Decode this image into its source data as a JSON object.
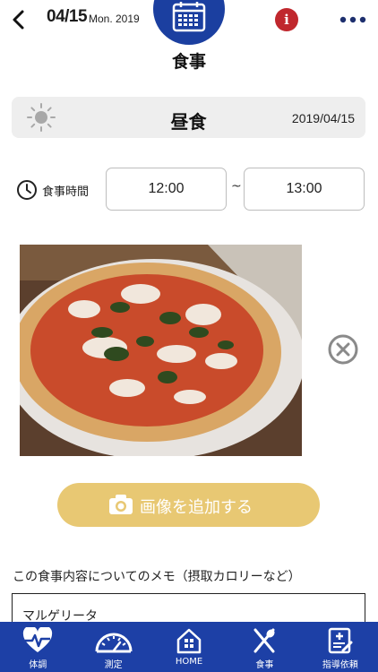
{
  "header": {
    "date_big": "04/15",
    "date_small": "Mon. 2019",
    "info_label": "i"
  },
  "page_title": "食事",
  "meal": {
    "name": "昼食",
    "date": "2019/04/15"
  },
  "meal_time": {
    "label": "食事時間",
    "start": "12:00",
    "separator": "~",
    "end": "13:00"
  },
  "add_image_label": "画像を追加する",
  "memo": {
    "label": "この食事内容についてのメモ（摂取カロリーなど）",
    "value": "マルゲリータ"
  },
  "tabs": [
    {
      "label": "体調",
      "icon": "heart-pulse-icon"
    },
    {
      "label": "測定",
      "icon": "gauge-icon"
    },
    {
      "label": "HOME",
      "icon": "home-icon"
    },
    {
      "label": "食事",
      "icon": "fork-spoon-icon"
    },
    {
      "label": "指導依頼",
      "icon": "clipboard-plus-icon"
    }
  ],
  "colors": {
    "brand_blue": "#1d40a6",
    "info_red": "#c0272d",
    "add_button": "#e8c873"
  }
}
